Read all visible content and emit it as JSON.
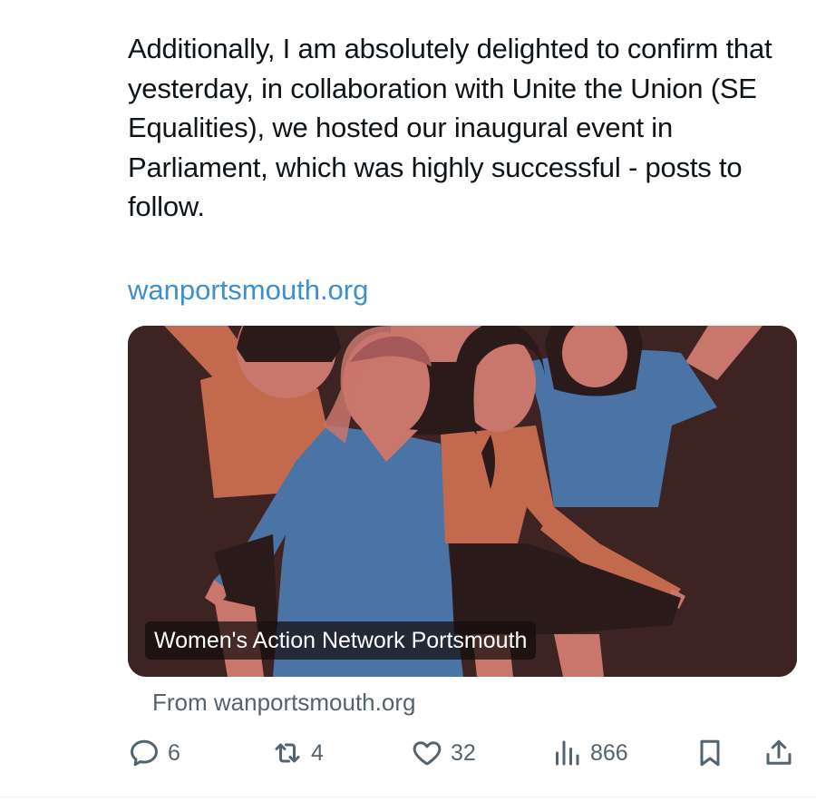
{
  "tweet": {
    "text": "Additionally, I am absolutely delighted to confirm that yesterday, in collaboration with Unite the Union (SE Equalities), we hosted our inaugural event in Parliament, which was highly successful - posts to follow.",
    "link": "wanportsmouth.org"
  },
  "card": {
    "caption": "Women's Action Network Portsmouth",
    "source": "From wanportsmouth.org"
  },
  "actions": {
    "replies": "6",
    "reposts": "4",
    "likes": "32",
    "views": "866"
  },
  "icons": {
    "reply": "reply-icon",
    "repost": "repost-icon",
    "like": "heart-icon",
    "views": "views-icon",
    "bookmark": "bookmark-icon",
    "share": "share-icon"
  },
  "colors": {
    "link": "#3d8fd1",
    "muted": "#536471",
    "card_background": "#3d2423",
    "skin": "#c9766c",
    "blue_clothing": "#4a73a6",
    "orange_clothing": "#c36a4e",
    "dark_clothing": "#2b1a1a"
  }
}
